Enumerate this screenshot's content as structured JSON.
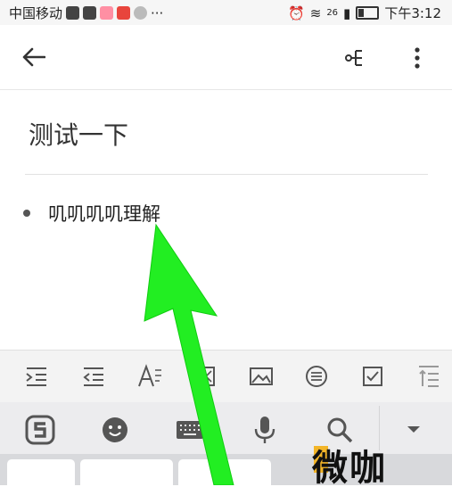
{
  "status_bar": {
    "carrier": "中国移动",
    "overflow": "···",
    "network": "26",
    "time": "下午3:12"
  },
  "note": {
    "title": "测试一下",
    "bullet_items": [
      "叽叽叽叽理解"
    ]
  },
  "format_toolbar": {
    "icons": [
      "indent-icon",
      "outdent-icon",
      "text-format-icon",
      "image-frame-icon",
      "image-icon",
      "list-icon",
      "checkbox-icon",
      "line-spacing-icon"
    ]
  },
  "keyboard_toolbar": {
    "icons": [
      "sogou-logo-icon",
      "emoji-icon",
      "keyboard-icon",
      "microphone-icon",
      "search-icon",
      "collapse-icon"
    ]
  },
  "watermark": {
    "text": "微咖"
  },
  "colors": {
    "arrow": "#22ee22",
    "watermark_accent": "#f3b528"
  }
}
